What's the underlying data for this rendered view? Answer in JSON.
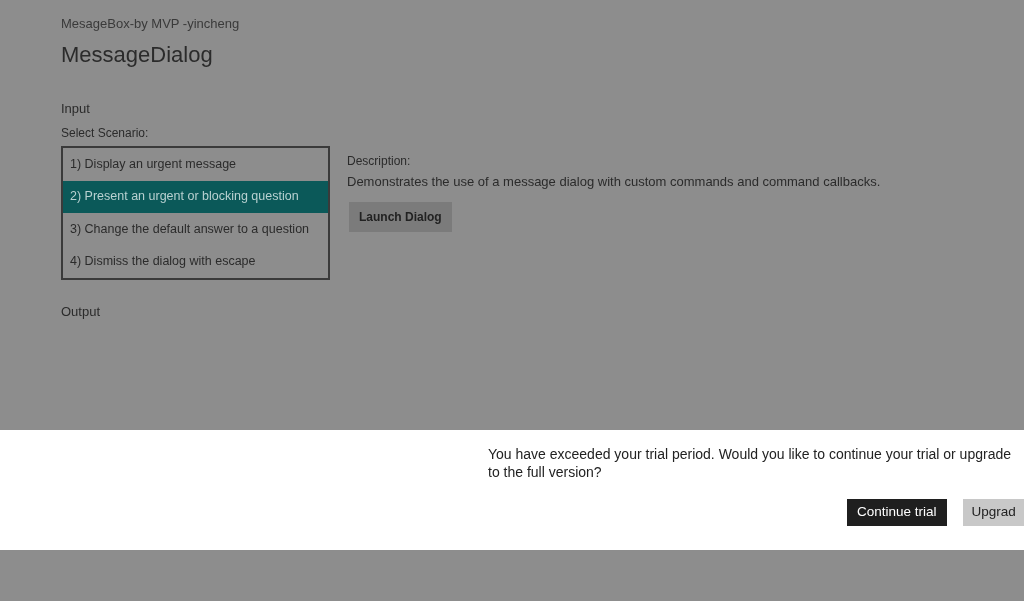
{
  "app": {
    "subtitle": "MesageBox-by MVP -yincheng",
    "title": "MessageDialog"
  },
  "input": {
    "heading": "Input",
    "list_label": "Select Scenario:",
    "scenarios": [
      {
        "label": "1) Display an urgent message",
        "selected": false
      },
      {
        "label": "2) Present an urgent or blocking question",
        "selected": true
      },
      {
        "label": "3) Change the default answer to a question",
        "selected": false
      },
      {
        "label": "4) Dismiss the dialog with escape",
        "selected": false
      }
    ],
    "description_label": "Description:",
    "description": "Demonstrates the use of a message dialog with custom commands and command callbacks.",
    "launch_button": "Launch Dialog"
  },
  "output": {
    "heading": "Output"
  },
  "dialog": {
    "message": "You have exceeded your trial period. Would you like to continue your trial or upgrade to the full version?",
    "buttons": [
      {
        "label": "Continue trial",
        "kind": "primary"
      },
      {
        "label": "Upgrad",
        "kind": "secondary"
      }
    ]
  }
}
